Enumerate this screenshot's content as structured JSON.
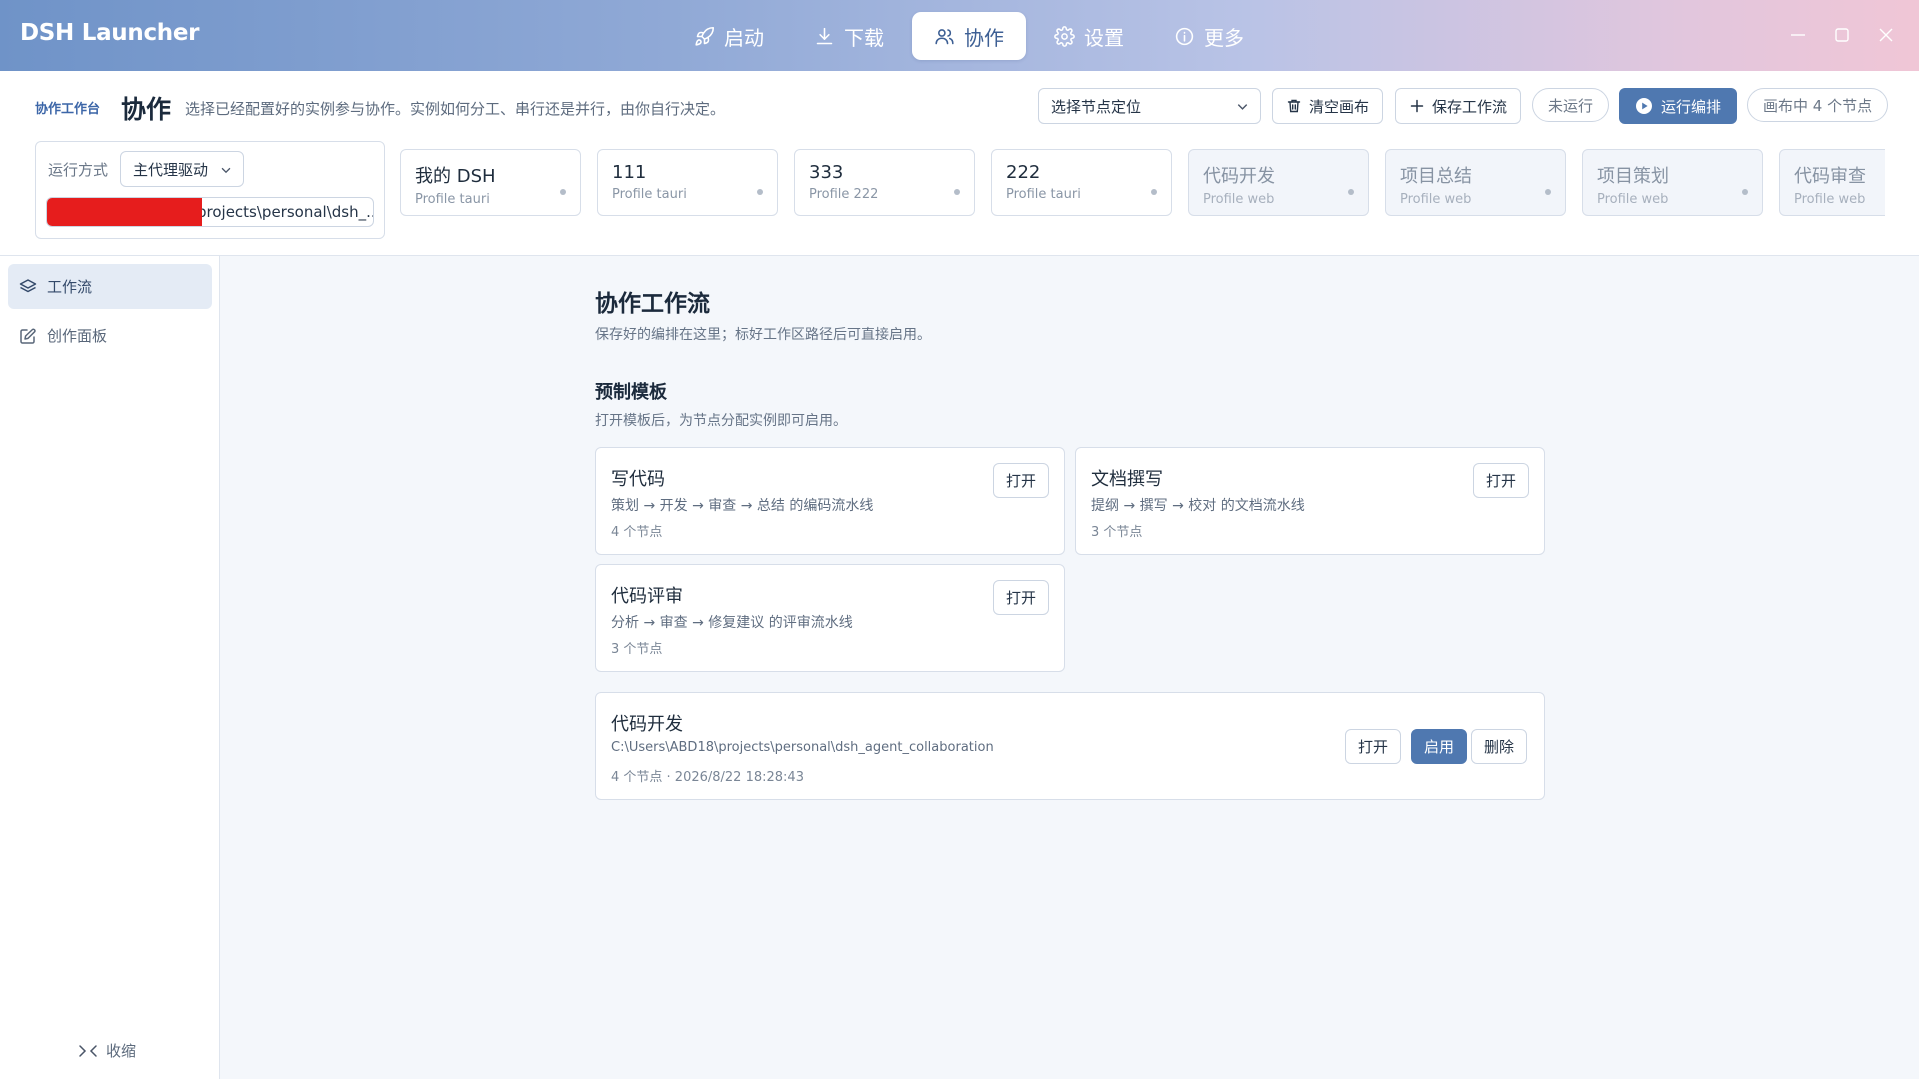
{
  "app": {
    "title": "DSH Launcher"
  },
  "nav": {
    "tabs": [
      {
        "label": "启动",
        "icon": "rocket-icon"
      },
      {
        "label": "下载",
        "icon": "download-icon"
      },
      {
        "label": "协作",
        "icon": "users-icon",
        "active": true
      },
      {
        "label": "设置",
        "icon": "gear-icon"
      },
      {
        "label": "更多",
        "icon": "info-icon"
      }
    ]
  },
  "header": {
    "kicker": "协作工作台",
    "title": "协作",
    "description": "选择已经配置好的实例参与协作。实例如何分工、串行还是并行，由你自行决定。",
    "node_select": "选择节点定位",
    "clear_label": "清空画布",
    "save_label": "保存工作流",
    "status_pill": "未运行",
    "run_label": "运行编排",
    "canvas_pill": "画布中 4 个节点",
    "run_mode": {
      "label": "运行方式",
      "value": "主代理驱动",
      "path": "projects\\personal\\dsh_..."
    },
    "instances": [
      {
        "name": "我的 DSH",
        "profile": "Profile tauri",
        "kind": "tauri"
      },
      {
        "name": "111",
        "profile": "Profile tauri",
        "kind": "tauri"
      },
      {
        "name": "333",
        "profile": "Profile 222",
        "kind": "tauri"
      },
      {
        "name": "222",
        "profile": "Profile tauri",
        "kind": "tauri"
      },
      {
        "name": "代码开发",
        "profile": "Profile web",
        "kind": "web"
      },
      {
        "name": "项目总结",
        "profile": "Profile web",
        "kind": "web"
      },
      {
        "name": "项目策划",
        "profile": "Profile web",
        "kind": "web"
      },
      {
        "name": "代码审查",
        "profile": "Profile web",
        "kind": "web"
      }
    ]
  },
  "sidebar": {
    "items": [
      {
        "label": "工作流",
        "icon": "layers-icon",
        "active": true
      },
      {
        "label": "创作面板",
        "icon": "edit-icon"
      }
    ],
    "collapse_label": "收缩"
  },
  "main": {
    "title": "协作工作流",
    "subtitle": "保存好的编排在这里；标好工作区路径后可直接启用。",
    "templates_title": "预制模板",
    "templates_subtitle": "打开模板后，为节点分配实例即可启用。",
    "templates": [
      {
        "title": "写代码",
        "desc": "策划 → 开发 → 审查 → 总结 的编码流水线",
        "meta": "4 个节点",
        "open": "打开"
      },
      {
        "title": "文档撰写",
        "desc": "提纲 → 撰写 → 校对 的文档流水线",
        "meta": "3 个节点",
        "open": "打开"
      },
      {
        "title": "代码评审",
        "desc": "分析 → 审查 → 修复建议 的评审流水线",
        "meta": "3 个节点",
        "open": "打开"
      }
    ],
    "workflow": {
      "title": "代码开发",
      "path": "C:\\Users\\ABD18\\projects\\personal\\dsh_agent_collaboration",
      "meta": "4 个节点 · 2026/8/22 18:28:43",
      "open": "打开",
      "enable": "启用",
      "delete": "删除"
    }
  },
  "colors": {
    "accent": "#4f78b0",
    "active_bg": "#e4ebf5",
    "redaction": "#e61d1d"
  }
}
